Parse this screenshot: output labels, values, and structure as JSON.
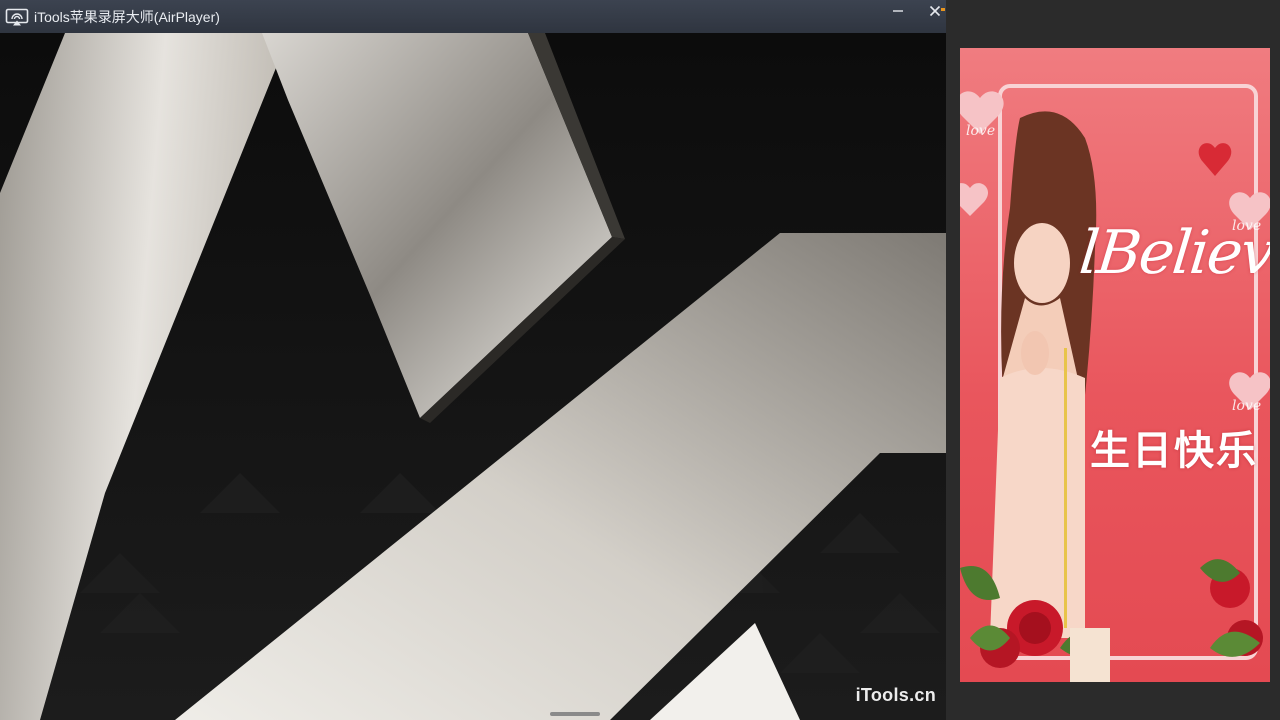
{
  "window": {
    "title": "iTools苹果录屏大师(AirPlayer)",
    "minimize_label": "−",
    "close_label": "✕"
  },
  "mirror": {
    "watermark": "iTools.cn"
  },
  "card": {
    "headline": "lBelieve",
    "subtitle": "生日快乐",
    "love_tags": [
      "love",
      "love",
      "love"
    ]
  },
  "colors": {
    "titlebar": "#353b46",
    "card_red": "#e9565d",
    "accent": "#e8951f"
  },
  "icons": {
    "app": "airplay-screen-icon",
    "minimize": "minimize-icon",
    "close": "close-icon"
  }
}
